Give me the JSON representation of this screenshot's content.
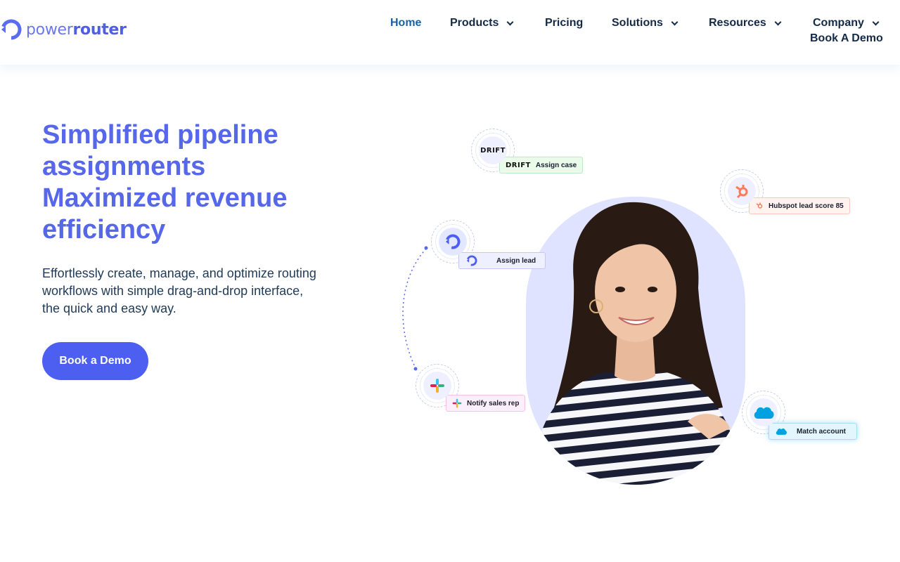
{
  "brand": {
    "name_part1": "power",
    "name_part2": "router",
    "color": "#5667ea"
  },
  "nav": {
    "items": [
      {
        "label": "Home",
        "active": true,
        "has_dropdown": false
      },
      {
        "label": "Products",
        "active": false,
        "has_dropdown": true
      },
      {
        "label": "Pricing",
        "active": false,
        "has_dropdown": false
      },
      {
        "label": "Solutions",
        "active": false,
        "has_dropdown": true
      },
      {
        "label": "Resources",
        "active": false,
        "has_dropdown": true
      },
      {
        "label": "Company",
        "active": false,
        "has_dropdown": true
      }
    ],
    "book_demo": "Book A Demo"
  },
  "hero": {
    "title_lines": [
      "Simplified pipeline",
      "assignments",
      "Maximized revenue",
      "efficiency"
    ],
    "subtitle": "Effortlessly create, manage, and optimize routing workflows with simple drag-and-drop interface, the quick and easy way.",
    "cta": "Book a Demo",
    "cta_color": "#4d5ff0"
  },
  "illustration": {
    "integrations": [
      {
        "icon": "drift-logo-icon",
        "logo_text": "DRIFT",
        "label": "Assign case"
      },
      {
        "icon": "hubspot-icon",
        "label": "Hubspot lead score 85"
      },
      {
        "icon": "powerrouter-icon",
        "label": "Assign lead"
      },
      {
        "icon": "slack-icon",
        "label": "Notify sales rep"
      },
      {
        "icon": "salesforce-icon",
        "logo_text": "salesforce",
        "label": "Match account"
      }
    ]
  }
}
